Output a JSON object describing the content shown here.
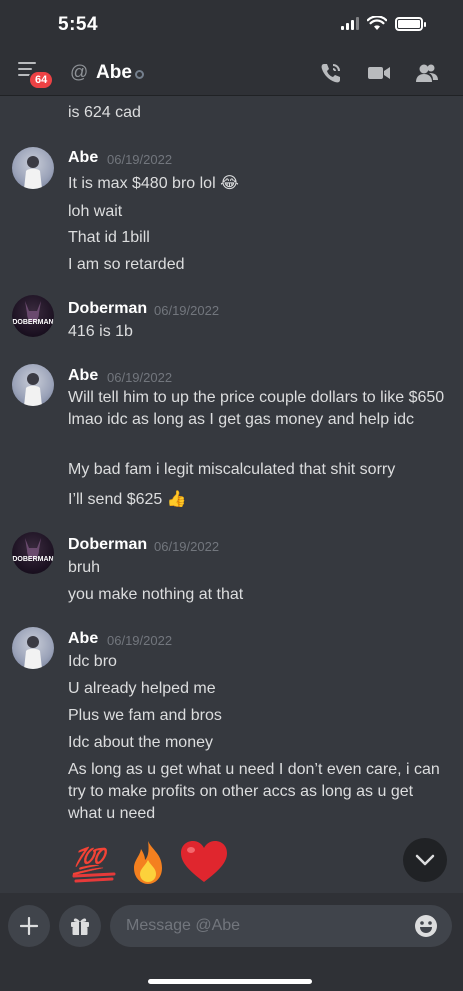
{
  "status_bar": {
    "time": "5:54"
  },
  "header": {
    "badge_count": "64",
    "at_symbol": "@",
    "dm_name": "Abe"
  },
  "messages": [
    {
      "type": "continuation",
      "lines": [
        "is 624 cad"
      ]
    },
    {
      "type": "group",
      "author": "Abe",
      "timestamp": "06/19/2022",
      "lines": [
        "It is max $480 bro lol 😂",
        "loh wait",
        "That id 1bill",
        "I am so retarded"
      ]
    },
    {
      "type": "group",
      "author": "Doberman",
      "timestamp": "06/19/2022",
      "avatar_text": "DOBERMAN",
      "lines": [
        "416 is 1b"
      ]
    },
    {
      "type": "group",
      "author": "Abe",
      "timestamp": "06/19/2022",
      "lines": [
        "Will tell him to up the price couple dollars to like $650 lmao idc as long as I get gas money and help idc",
        "My bad fam i legit miscalculated that shit sorry",
        "I’ll send $625 👍"
      ]
    },
    {
      "type": "group",
      "author": "Doberman",
      "timestamp": "06/19/2022",
      "avatar_text": "DOBERMAN",
      "lines": [
        "bruh",
        "you make nothing at that"
      ]
    },
    {
      "type": "group",
      "author": "Abe",
      "timestamp": "06/19/2022",
      "lines": [
        "Idc bro",
        "U already helped me",
        "Plus we fam and bros",
        "Idc about the money",
        "As long as u get what u need I don’t even care, i can try to make profits on other accs as long as u get what u need"
      ]
    }
  ],
  "emoji_message": [
    "💯",
    "🔥",
    "❤️"
  ],
  "composer": {
    "placeholder": "Message @Abe"
  }
}
